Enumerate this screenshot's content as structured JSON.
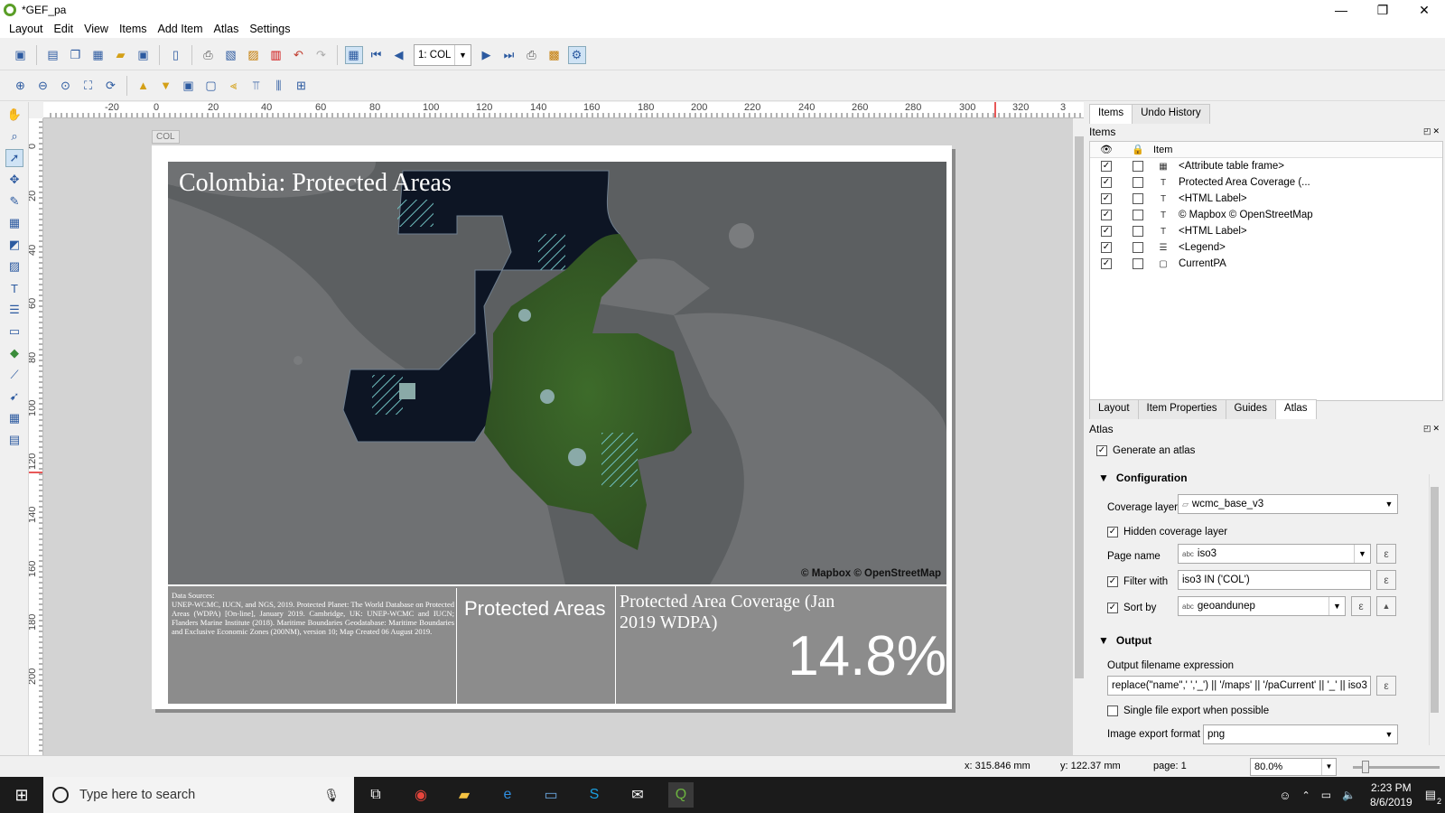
{
  "window": {
    "title": "*GEF_pa",
    "controls": [
      "—",
      "❐",
      "✕"
    ]
  },
  "menu": [
    "Layout",
    "Edit",
    "View",
    "Items",
    "Add Item",
    "Atlas",
    "Settings"
  ],
  "toolbar": {
    "atlas_page": "1: COL"
  },
  "rulers": {
    "h": [
      "-20",
      "0",
      "20",
      "40",
      "60",
      "80",
      "100",
      "120",
      "140",
      "160",
      "180",
      "200",
      "220",
      "240",
      "260",
      "280",
      "300",
      "320",
      "3"
    ],
    "v": [
      "0",
      "20",
      "40",
      "60",
      "80",
      "100",
      "120",
      "140",
      "160",
      "180",
      "200"
    ]
  },
  "page": {
    "label": "COL",
    "map_title": "Colombia: Protected Areas",
    "attribution": "© Mapbox © OpenStreetMap",
    "sources_html_text": "Data Sources:",
    "sources_body": "UNEP-WCMC, IUCN, and NGS, 2019. Protected Planet: The World Database on Protected Areas (WDPA) [On-line], January 2019. Cambridge, UK: UNEP-WCMC and IUCN; Flanders Marine Institute (2018). Maritime Boundaries Geodatabase: Maritime Boundaries and Exclusive Economic Zones (200NM), version 10; Map Created 06 August 2019.",
    "legend_label": "Protected Areas",
    "coverage_label": "Protected Area Coverage (Jan 2019 WDPA)",
    "coverage_value": "14.8%"
  },
  "statusbar": {
    "x": "x: 315.846 mm",
    "y": "y: 122.37 mm",
    "page": "page: 1",
    "zoom": "80.0%"
  },
  "items_panel": {
    "tabs": [
      "Items",
      "Undo History"
    ],
    "header": "Items",
    "column_item": "Item",
    "rows": [
      {
        "icon": "▦",
        "label": "<Attribute table frame>"
      },
      {
        "icon": "T",
        "label": "Protected Area Coverage (..."
      },
      {
        "icon": "T",
        "label": "<HTML Label>"
      },
      {
        "icon": "T",
        "label": "© Mapbox © OpenStreetMap"
      },
      {
        "icon": "T",
        "label": "<HTML Label>"
      },
      {
        "icon": "☰",
        "label": "<Legend>"
      },
      {
        "icon": "▢",
        "label": "CurrentPA"
      }
    ]
  },
  "props_panel": {
    "tabs": [
      "Layout",
      "Item Properties",
      "Guides",
      "Atlas"
    ],
    "header": "Atlas",
    "generate": "Generate an atlas",
    "configuration": "Configuration",
    "coverage_layer_label": "Coverage layer",
    "coverage_layer_value": "wcmc_base_v3",
    "hidden_coverage": "Hidden coverage layer",
    "page_name_label": "Page name",
    "page_name_value": "iso3",
    "filter_label": "Filter with",
    "filter_value": "iso3  IN ('COL')",
    "sort_label": "Sort by",
    "sort_value": "geoandunep",
    "output": "Output",
    "output_expr_label": "Output filename expression",
    "output_expr_value": "replace(\"name\",' ','_') || '/maps' || '/paCurrent' || '_' || iso3",
    "single_file": "Single file export when possible",
    "image_format_label": "Image export format",
    "image_format_value": "png",
    "abc": "abc",
    "expr_icon": "ε"
  },
  "taskbar": {
    "search_placeholder": "Type here to search",
    "time": "2:23 PM",
    "date": "8/6/2019",
    "notif_count": "2"
  }
}
